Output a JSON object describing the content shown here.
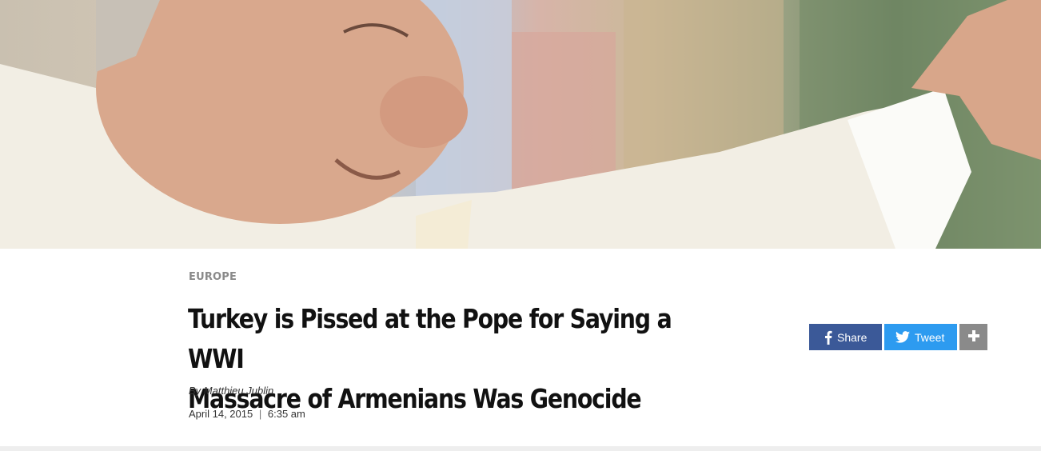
{
  "article": {
    "section": "EUROPE",
    "headline_line1": "Turkey is Pissed at the Pope for Saying a WWI",
    "headline_line2": "Massacre of Armenians Was Genocide",
    "byline": "By Matthieu Jublin",
    "date": "April 14, 2015",
    "date_separator": "|",
    "time": "6:35 am"
  },
  "share": {
    "facebook_label": "Share",
    "twitter_label": "Tweet",
    "more_icon": "plus-icon",
    "facebook_icon": "facebook-icon",
    "twitter_icon": "twitter-bird-icon"
  },
  "colors": {
    "facebook": "#3b5998",
    "twitter": "#2d9bf0",
    "more": "#8a8a8a",
    "kicker": "#8a8a8a",
    "headline": "#111111"
  }
}
